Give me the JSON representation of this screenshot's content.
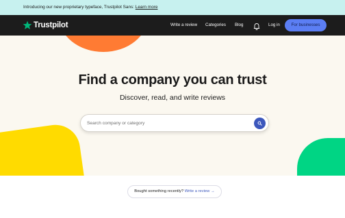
{
  "announcement": {
    "text": "Introducing our new proprietary typeface, Trustpilot Sans:",
    "link": "Learn more"
  },
  "nav": {
    "logo_text": "Trustpilot",
    "links": [
      "Write a review",
      "Categories",
      "Blog"
    ],
    "login": "Log in",
    "business_button": "For businesses"
  },
  "hero": {
    "title": "Find a company you can trust",
    "subtitle": "Discover, read, and write reviews",
    "search_placeholder": "Search company or category"
  },
  "prompt": {
    "text": "Bought something recently?",
    "link": "Write a review",
    "arrow": "→"
  },
  "colors": {
    "announcement_bg": "#c7f1ef",
    "nav_bg": "#1c1c1c",
    "brand_green": "#00b67a",
    "business_button": "#5b7ef4",
    "hero_bg": "#fbf8f0",
    "search_button": "#3c57bc",
    "shape_orange": "#ff7b33",
    "shape_yellow": "#ffdb00",
    "shape_green": "#00d584"
  },
  "icons": {
    "logo": "star-icon",
    "notifications": "bell-icon",
    "search": "search-icon"
  }
}
